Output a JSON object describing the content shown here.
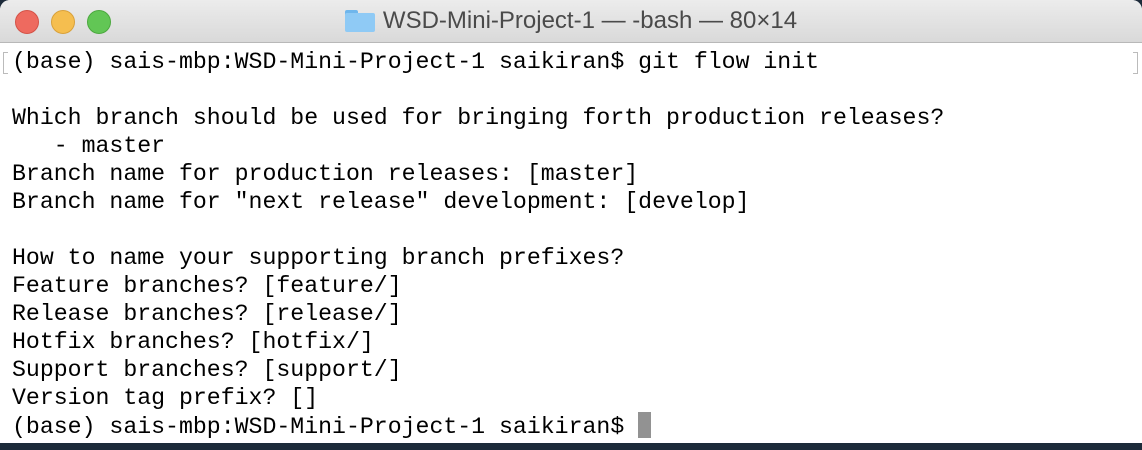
{
  "window": {
    "title": "WSD-Mini-Project-1 — -bash — 80×14"
  },
  "terminal": {
    "lines": [
      "(base) sais-mbp:WSD-Mini-Project-1 saikiran$ git flow init",
      "",
      "Which branch should be used for bringing forth production releases?",
      "   - master",
      "Branch name for production releases: [master]",
      "Branch name for \"next release\" development: [develop]",
      "",
      "How to name your supporting branch prefixes?",
      "Feature branches? [feature/]",
      "Release branches? [release/]",
      "Hotfix branches? [hotfix/]",
      "Support branches? [support/]",
      "Version tag prefix? []"
    ],
    "prompt": "(base) sais-mbp:WSD-Mini-Project-1 saikiran$ "
  }
}
